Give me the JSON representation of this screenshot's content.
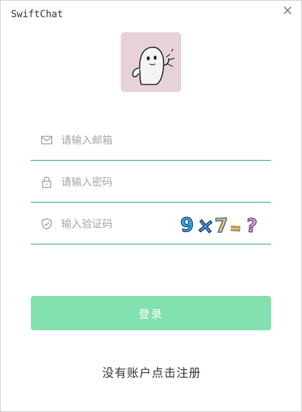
{
  "window": {
    "title": "SwiftChat"
  },
  "avatar": {
    "alt": "meme-character-avatar"
  },
  "fields": {
    "email": {
      "placeholder": "请输入邮箱",
      "value": ""
    },
    "password": {
      "placeholder": "请输入密码",
      "value": ""
    },
    "captcha": {
      "placeholder": "输入验证码",
      "value": "",
      "image_text": "9×7=?"
    }
  },
  "buttons": {
    "login": "登录"
  },
  "links": {
    "register": "没有账户点击注册"
  },
  "colors": {
    "accent_line": "#1aa97a",
    "login_button": "#83e0af",
    "avatar_bg": "#e7d2d8"
  }
}
